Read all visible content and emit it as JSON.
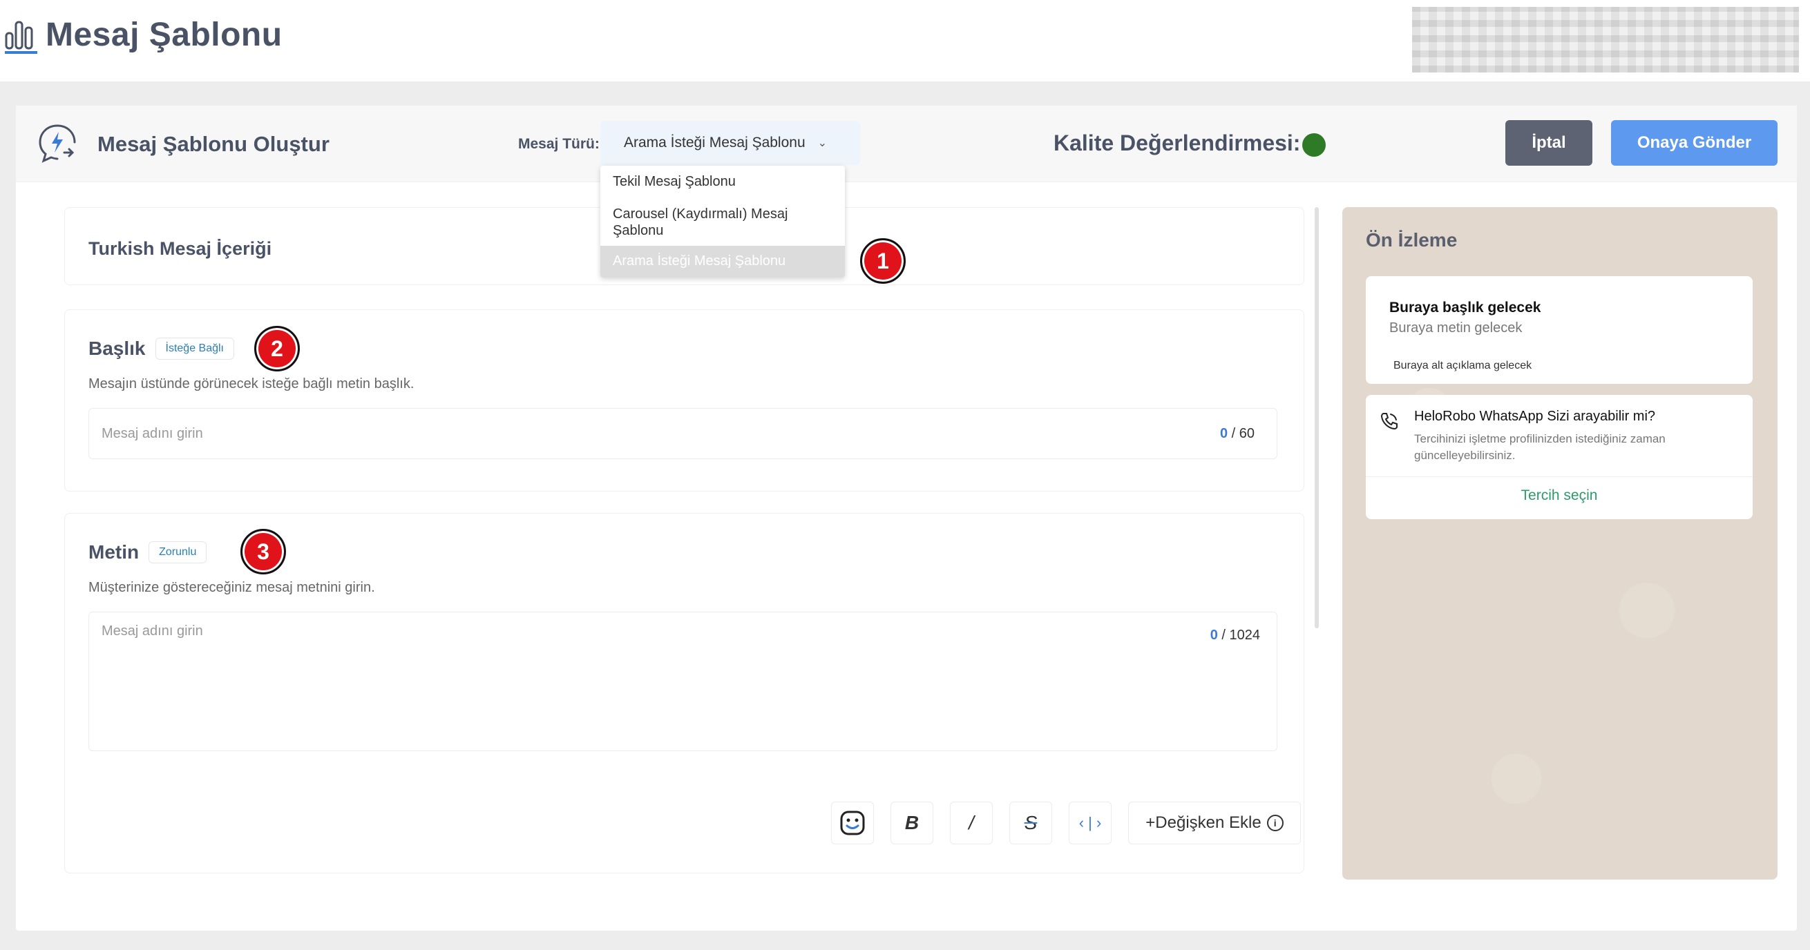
{
  "page": {
    "title": "Mesaj Şablonu"
  },
  "header": {
    "title": "Mesaj Şablonu Oluştur",
    "type_label": "Mesaj Türü:",
    "type_value": "Arama İsteği Mesaj Şablonu",
    "quality_label": "Kalite Değerlendirmesi:",
    "quality_color": "#2f7a27",
    "cancel_label": "İptal",
    "submit_label": "Onaya Gönder"
  },
  "dropdown": {
    "options": [
      "Tekil Mesaj Şablonu",
      "Carousel (Kaydırmalı) Mesaj Şablonu",
      "Arama İsteği Mesaj Şablonu"
    ]
  },
  "content": {
    "title": "Turkish Mesaj İçeriği",
    "header_section": {
      "label": "Başlık",
      "badge": "İsteğe Bağlı",
      "description": "Mesajın üstünde görünecek isteğe bağlı metin başlık.",
      "placeholder": "Mesaj adını girin",
      "count": "0",
      "max": "/ 60"
    },
    "body_section": {
      "label": "Metin",
      "badge": "Zorunlu",
      "description": "Müşterinize göstereceğiniz mesaj metnini girin.",
      "placeholder": "Mesaj adını girin",
      "count": "0",
      "max": "/ 1024"
    },
    "toolbar": {
      "bold": "B",
      "italic": "/",
      "strike": "S",
      "code": "‹ | ›",
      "add_variable": "+Değişken Ekle",
      "info": "i"
    }
  },
  "preview": {
    "title": "Ön İzleme",
    "heading": "Buraya başlık gelecek",
    "body": "Buraya metin gelecek",
    "footer": "Buraya alt açıklama gelecek",
    "call_title": "HeloRobo WhatsApp Sizi arayabilir mi?",
    "call_sub": "Tercihinizi işletme profilinizden istediğiniz zaman güncelleyebilirsiniz.",
    "call_link": "Tercih seçin"
  },
  "markers": [
    "1",
    "2",
    "3"
  ]
}
